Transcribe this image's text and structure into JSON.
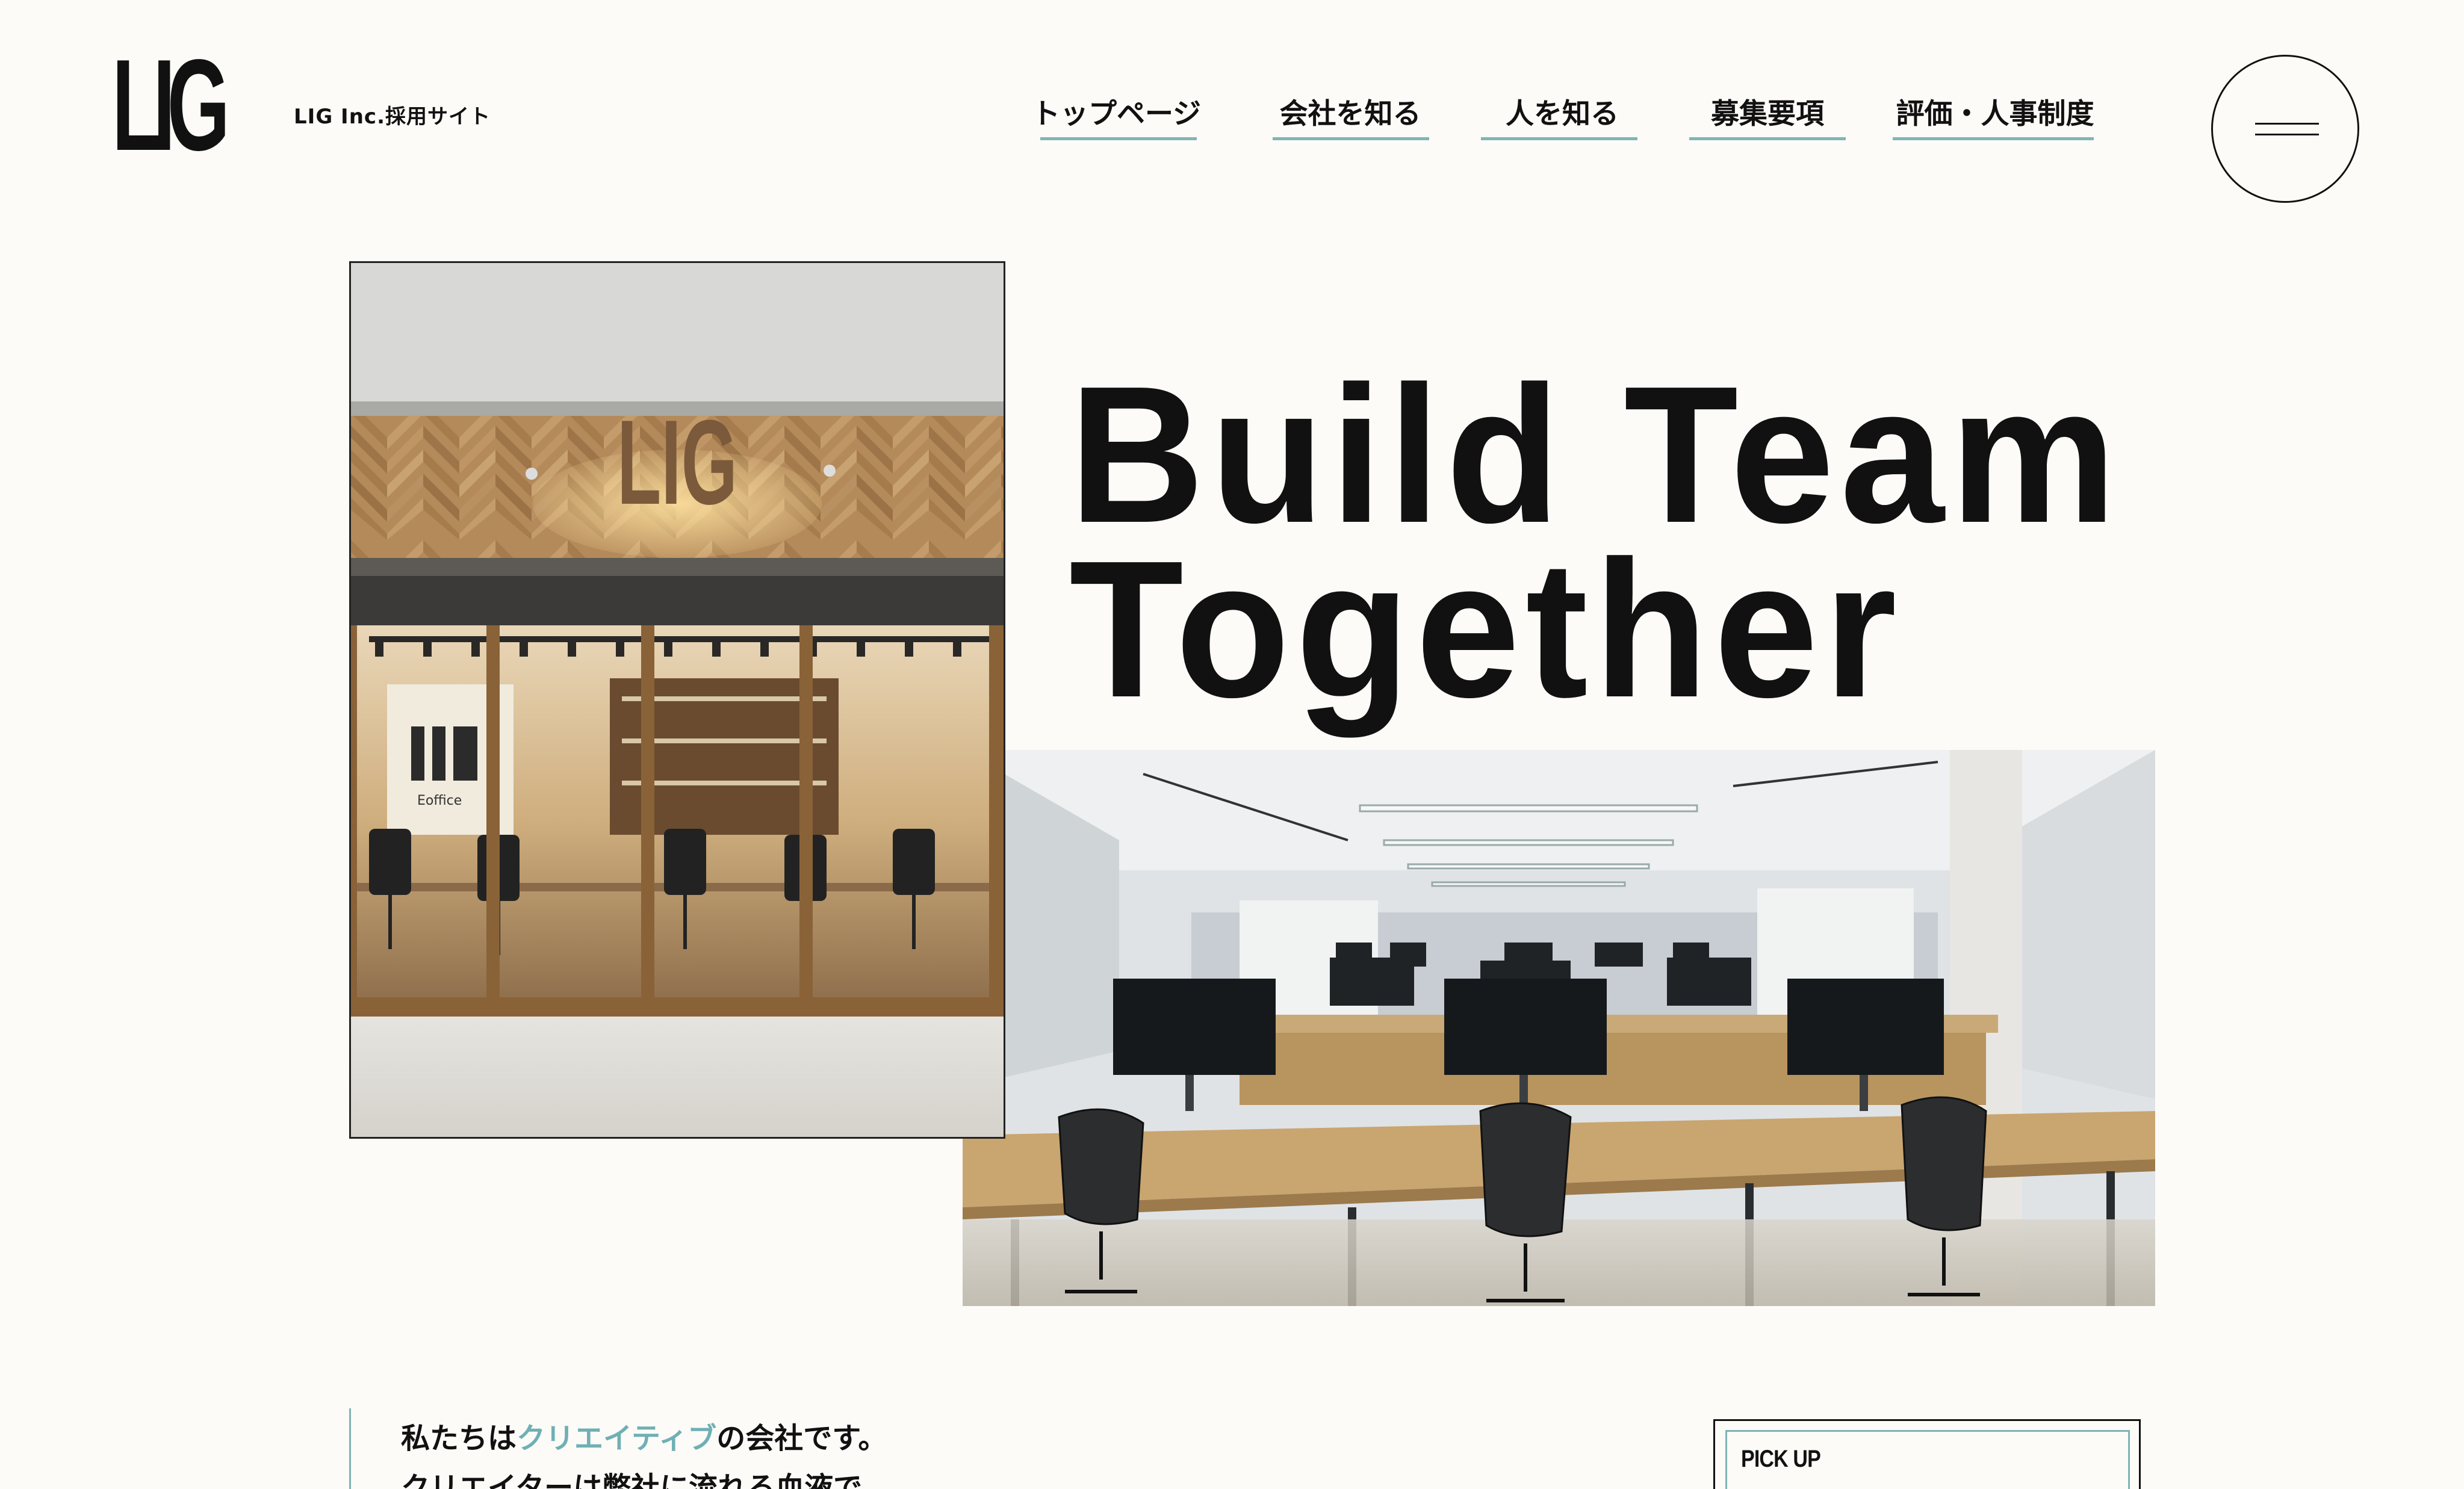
{
  "header": {
    "logo_text": "LIG",
    "site_label": "LIG Inc.採用サイト",
    "nav": [
      {
        "label": "トップページ"
      },
      {
        "label": "会社を知る"
      },
      {
        "label": "人を知る"
      },
      {
        "label": "募集要項"
      },
      {
        "label": "評価・人事制度"
      }
    ],
    "menu_icon": "hamburger-icon"
  },
  "hero": {
    "title_line1": "Build Team",
    "title_line2": "Together",
    "store_sign": "LIG",
    "store_window_text": "Eoffice"
  },
  "intro": {
    "line1_prefix": "私たちは",
    "line1_accent": "クリエイティブ",
    "line1_suffix": "の会社です。",
    "line2": "クリエイターは弊社に流れる血液で"
  },
  "pickup": {
    "label": "PICK UP"
  },
  "colors": {
    "background": "#fcfbf8",
    "accent": "#7fb4b4",
    "text": "#111111"
  }
}
